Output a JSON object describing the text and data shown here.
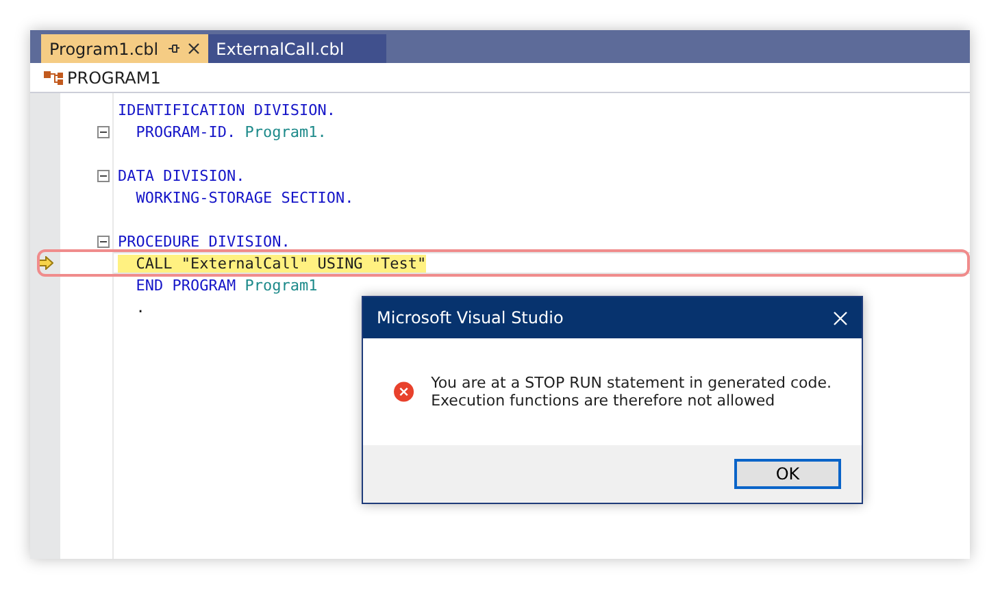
{
  "tabs": [
    {
      "label": "Program1.cbl",
      "selected": true
    },
    {
      "label": "ExternalCall.cbl",
      "selected": false
    }
  ],
  "breadcrumb": {
    "label": "PROGRAM1"
  },
  "code_lines": [
    {
      "kind": "code",
      "tokens": [
        {
          "kind": "keyword",
          "text": "IDENTIFICATION DIVISION."
        }
      ]
    },
    {
      "kind": "code",
      "fold": true,
      "tokens": [
        {
          "kind": "keyword",
          "text": "  PROGRAM-ID. "
        },
        {
          "kind": "name",
          "text": "Program1."
        }
      ]
    },
    {
      "kind": "blank"
    },
    {
      "kind": "code",
      "fold": true,
      "tokens": [
        {
          "kind": "keyword",
          "text": "DATA DIVISION."
        }
      ]
    },
    {
      "kind": "code",
      "tokens": [
        {
          "kind": "keyword",
          "text": "  WORKING-STORAGE SECTION."
        }
      ]
    },
    {
      "kind": "blank"
    },
    {
      "kind": "code",
      "fold": true,
      "tokens": [
        {
          "kind": "keyword",
          "text": "PROCEDURE DIVISION."
        }
      ]
    },
    {
      "kind": "code",
      "current": true,
      "callout": true,
      "tokens": [
        {
          "kind": "plain",
          "text": "  CALL \"ExternalCall\" USING \"Test\""
        }
      ]
    },
    {
      "kind": "code",
      "tokens": [
        {
          "kind": "keyword",
          "text": "  END PROGRAM "
        },
        {
          "kind": "name",
          "text": "Program1"
        }
      ]
    },
    {
      "kind": "code",
      "tokens": [
        {
          "kind": "plain",
          "text": "  ."
        }
      ]
    }
  ],
  "dialog": {
    "title": "Microsoft Visual Studio",
    "message_lines": [
      "You are at a STOP RUN statement in generated code.",
      "Execution functions are therefore not allowed"
    ],
    "buttons": [
      "OK"
    ]
  }
}
